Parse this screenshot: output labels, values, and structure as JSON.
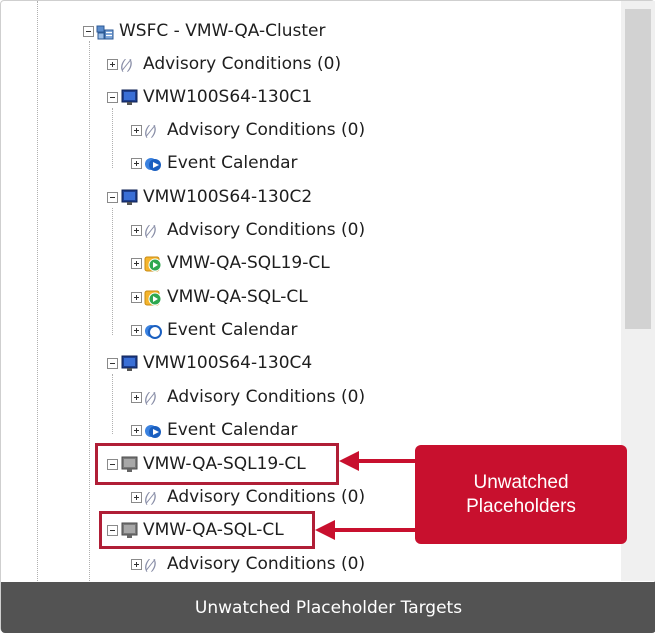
{
  "tree": {
    "root": {
      "label": "WSFC - VMW-QA-Cluster",
      "icon": "cluster-icon",
      "expanded": true
    },
    "root_advisory": {
      "label": "Advisory Conditions (0)",
      "icon": "advisory-icon"
    },
    "nodes": [
      {
        "label": "VMW100S64-130C1",
        "icon": "computer-monitor-icon",
        "expanded": true,
        "children": [
          {
            "label": "Advisory Conditions (0)",
            "icon": "advisory-icon"
          },
          {
            "label": "Event Calendar",
            "icon": "event-calendar-icon"
          }
        ]
      },
      {
        "label": "VMW100S64-130C2",
        "icon": "computer-monitor-icon",
        "expanded": true,
        "children": [
          {
            "label": "Advisory Conditions (0)",
            "icon": "advisory-icon"
          },
          {
            "label": "VMW-QA-SQL19-CL",
            "icon": "sql-instance-icon"
          },
          {
            "label": "VMW-QA-SQL-CL",
            "icon": "sql-instance-icon"
          },
          {
            "label": "Event Calendar",
            "icon": "event-calendar-icon"
          }
        ]
      },
      {
        "label": "VMW100S64-130C4",
        "icon": "computer-monitor-icon",
        "expanded": true,
        "children": [
          {
            "label": "Advisory Conditions (0)",
            "icon": "advisory-icon"
          },
          {
            "label": "Event Calendar",
            "icon": "event-calendar-icon"
          }
        ]
      },
      {
        "label": "VMW-QA-SQL19-CL",
        "icon": "unwatched-placeholder-icon",
        "expanded": true,
        "highlighted": true,
        "children": [
          {
            "label": "Advisory Conditions (0)",
            "icon": "advisory-icon"
          }
        ]
      },
      {
        "label": "VMW-QA-SQL-CL",
        "icon": "unwatched-placeholder-icon",
        "expanded": true,
        "highlighted": true,
        "children": [
          {
            "label": "Advisory Conditions (0)",
            "icon": "advisory-icon"
          }
        ]
      }
    ]
  },
  "callout": {
    "line1": "Unwatched",
    "line2": "Placeholders",
    "color": "#c8102e"
  },
  "caption": "Unwatched Placeholder Targets",
  "colors": {
    "highlight_border": "#b01e36",
    "caption_bg": "#535353"
  }
}
